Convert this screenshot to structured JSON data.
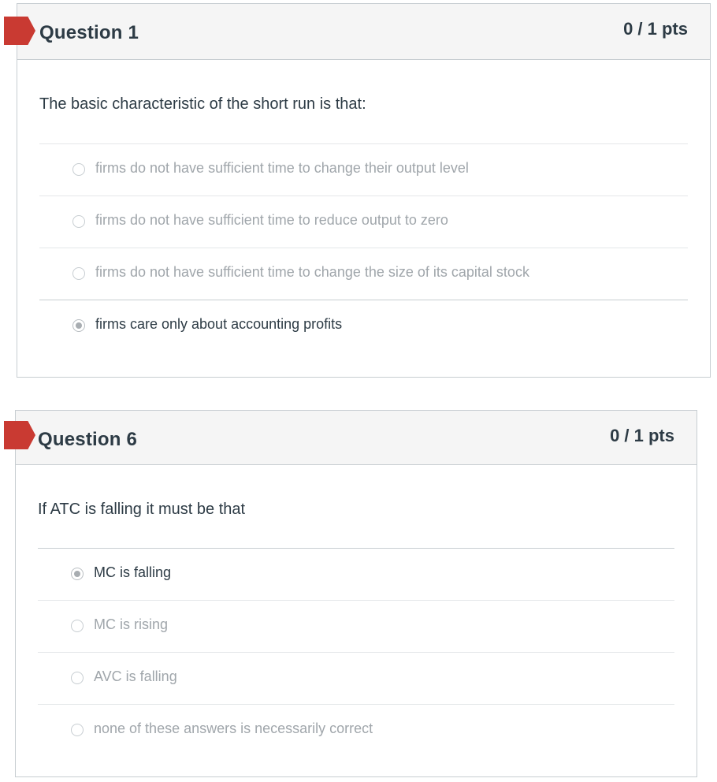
{
  "questions": [
    {
      "title": "Question 1",
      "points": "0 / 1 pts",
      "text": "The basic characteristic of the short run is that:",
      "answers": [
        {
          "label": "firms do not have sufficient time to change their output level",
          "selected": false
        },
        {
          "label": "firms do not have sufficient time to reduce output to zero",
          "selected": false
        },
        {
          "label": "firms do not have sufficient time to change the size of its capital stock",
          "selected": false
        },
        {
          "label": "firms care only about accounting profits",
          "selected": true
        }
      ]
    },
    {
      "title": "Question 6",
      "points": "0 / 1 pts",
      "text": "If ATC is falling it must be that",
      "answers": [
        {
          "label": "MC is falling",
          "selected": true
        },
        {
          "label": "MC is rising",
          "selected": false
        },
        {
          "label": "AVC is falling",
          "selected": false
        },
        {
          "label": "none of these answers is necessarily correct",
          "selected": false
        }
      ]
    }
  ],
  "colors": {
    "flag": "#c93a32",
    "header_bg": "#f5f5f5",
    "border": "#c7cdd1",
    "text": "#2d3b45",
    "muted_text": "#a0a6ab"
  },
  "icons": {
    "flag": "incorrect-flag-icon",
    "radio": "radio-button-icon"
  }
}
